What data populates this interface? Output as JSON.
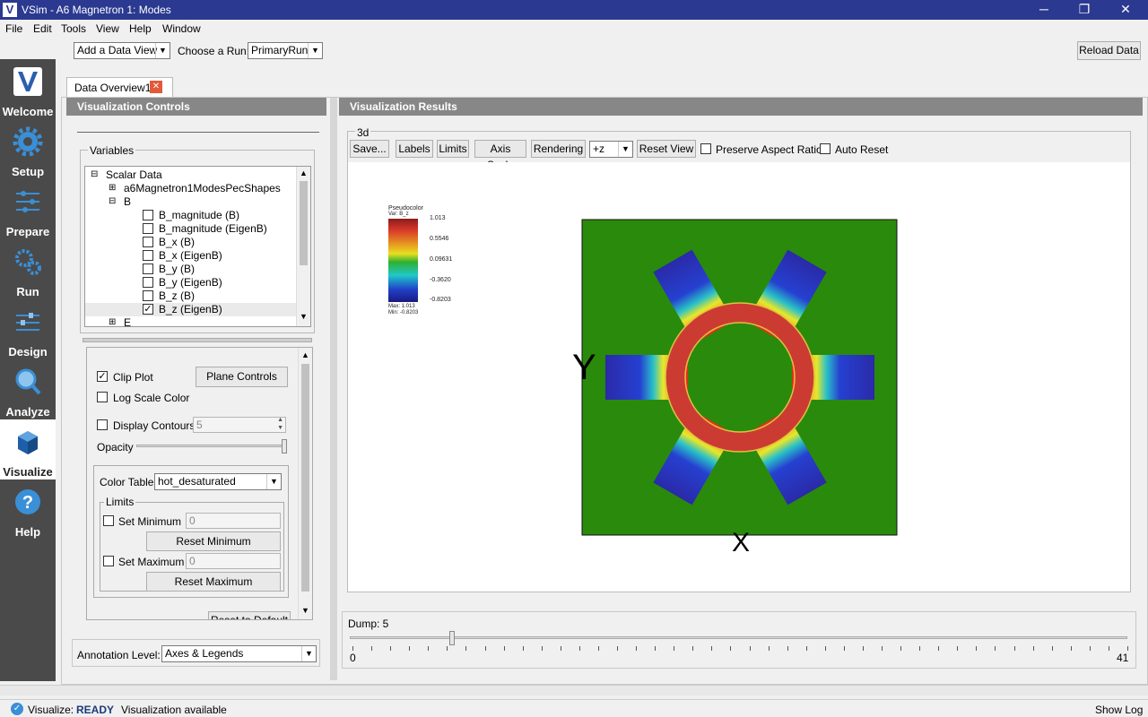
{
  "window": {
    "title": "VSim - A6 Magnetron 1: Modes",
    "minimize": "─",
    "restore": "❐",
    "close": "✕"
  },
  "menu": [
    "File",
    "Edit",
    "Tools",
    "View",
    "Help",
    "Window"
  ],
  "sidebar": [
    {
      "label": "Welcome",
      "icon": "vsim-logo-icon"
    },
    {
      "label": "Setup",
      "icon": "gear-icon"
    },
    {
      "label": "Prepare",
      "icon": "sliders-icon"
    },
    {
      "label": "Run",
      "icon": "gears-icon"
    },
    {
      "label": "Design",
      "icon": "design-icon"
    },
    {
      "label": "Analyze",
      "icon": "magnifier-icon"
    },
    {
      "label": "Visualize",
      "icon": "cube-icon"
    },
    {
      "label": "Help",
      "icon": "question-icon"
    }
  ],
  "toolbar": {
    "add_view": "Add a Data View",
    "choose_run_label": "Choose a Run:",
    "run": "PrimaryRun",
    "reload": "Reload Data"
  },
  "tab": {
    "label": "Data Overview1"
  },
  "controls": {
    "header": "Visualization Controls",
    "variables_label": "Variables",
    "tree": {
      "scalar": "Scalar Data",
      "shapes": "a6Magnetron1ModesPecShapes",
      "b": "B",
      "items": [
        "B_magnitude (B)",
        "B_magnitude (EigenB)",
        "B_x (B)",
        "B_x (EigenB)",
        "B_y (B)",
        "B_y (EigenB)",
        "B_z (B)",
        "B_z (EigenB)"
      ],
      "checked_index": 7,
      "next": "E"
    },
    "clip_plot": "Clip Plot",
    "plane_controls": "Plane Controls",
    "log_scale": "Log Scale Color",
    "display_contours": "Display Contours",
    "contours_value": "5",
    "opacity": "Opacity",
    "color_table_label": "Color Table",
    "color_table": "hot_desaturated",
    "limits": "Limits",
    "set_min": "Set Minimum",
    "min_value": "0",
    "reset_min": "Reset Minimum",
    "set_max": "Set Maximum",
    "max_value": "0",
    "reset_max": "Reset Maximum",
    "reset_default": "Reset to Default",
    "annotation_label": "Annotation Level:",
    "annotation": "Axes & Legends"
  },
  "results": {
    "header": "Visualization Results",
    "group": "3d",
    "save": "Save...",
    "labels": "Labels",
    "limits": "Limits",
    "axis_scale": "Axis Scale",
    "rendering": "Rendering",
    "view_dir": "+z",
    "reset_view": "Reset View",
    "preserve": "Preserve Aspect Ratio",
    "auto_reset": "Auto Reset"
  },
  "legend": {
    "title": "Pseudocolor",
    "var": "Var: B_z",
    "ticks": [
      "1.013",
      "0.5546",
      "0.09631",
      "-0.3620",
      "-0.8203"
    ],
    "max": "Max: 1.013",
    "min": "Min: -0.8203"
  },
  "plot": {
    "xlabel": "X",
    "ylabel": "Y",
    "background": "#2a8a0c",
    "ring": "#cc3b32"
  },
  "dump": {
    "label": "Dump: 5",
    "min": "0",
    "max": "41",
    "value": 5,
    "total": 41
  },
  "status": {
    "mode": "Visualize:",
    "state": "READY",
    "message": "Visualization available",
    "showlog": "Show Log"
  }
}
